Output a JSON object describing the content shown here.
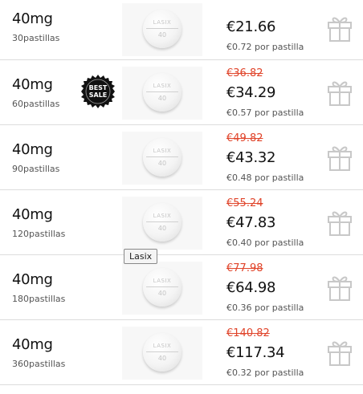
{
  "products": [
    {
      "dose": "40mg",
      "quantity": "30pastillas",
      "old_price": "",
      "price": "€21.66",
      "per_unit": "€0.72 por pastilla"
    },
    {
      "dose": "40mg",
      "quantity": "60pastillas",
      "old_price": "€36.82",
      "price": "€34.29",
      "per_unit": "€0.57 por pastilla"
    },
    {
      "dose": "40mg",
      "quantity": "90pastillas",
      "old_price": "€49.82",
      "price": "€43.32",
      "per_unit": "€0.48 por pastilla"
    },
    {
      "dose": "40mg",
      "quantity": "120pastillas",
      "old_price": "€55.24",
      "price": "€47.83",
      "per_unit": "€0.40 por pastilla"
    },
    {
      "dose": "40mg",
      "quantity": "180pastillas",
      "old_price": "€77.98",
      "price": "€64.98",
      "per_unit": "€0.36 por pastilla"
    },
    {
      "dose": "40mg",
      "quantity": "360pastillas",
      "old_price": "€140.82",
      "price": "€117.34",
      "per_unit": "€0.32 por pastilla"
    }
  ],
  "pill": {
    "imprint_top": "LASIX",
    "imprint_bottom": "40"
  },
  "badge": {
    "line1": "BEST",
    "line2": "SALE"
  },
  "tooltip": "Lasix",
  "colors": {
    "strike_price": "#e0442a",
    "gift_outline": "#c8c8c8"
  },
  "icons": {
    "gift": "gift-icon"
  }
}
